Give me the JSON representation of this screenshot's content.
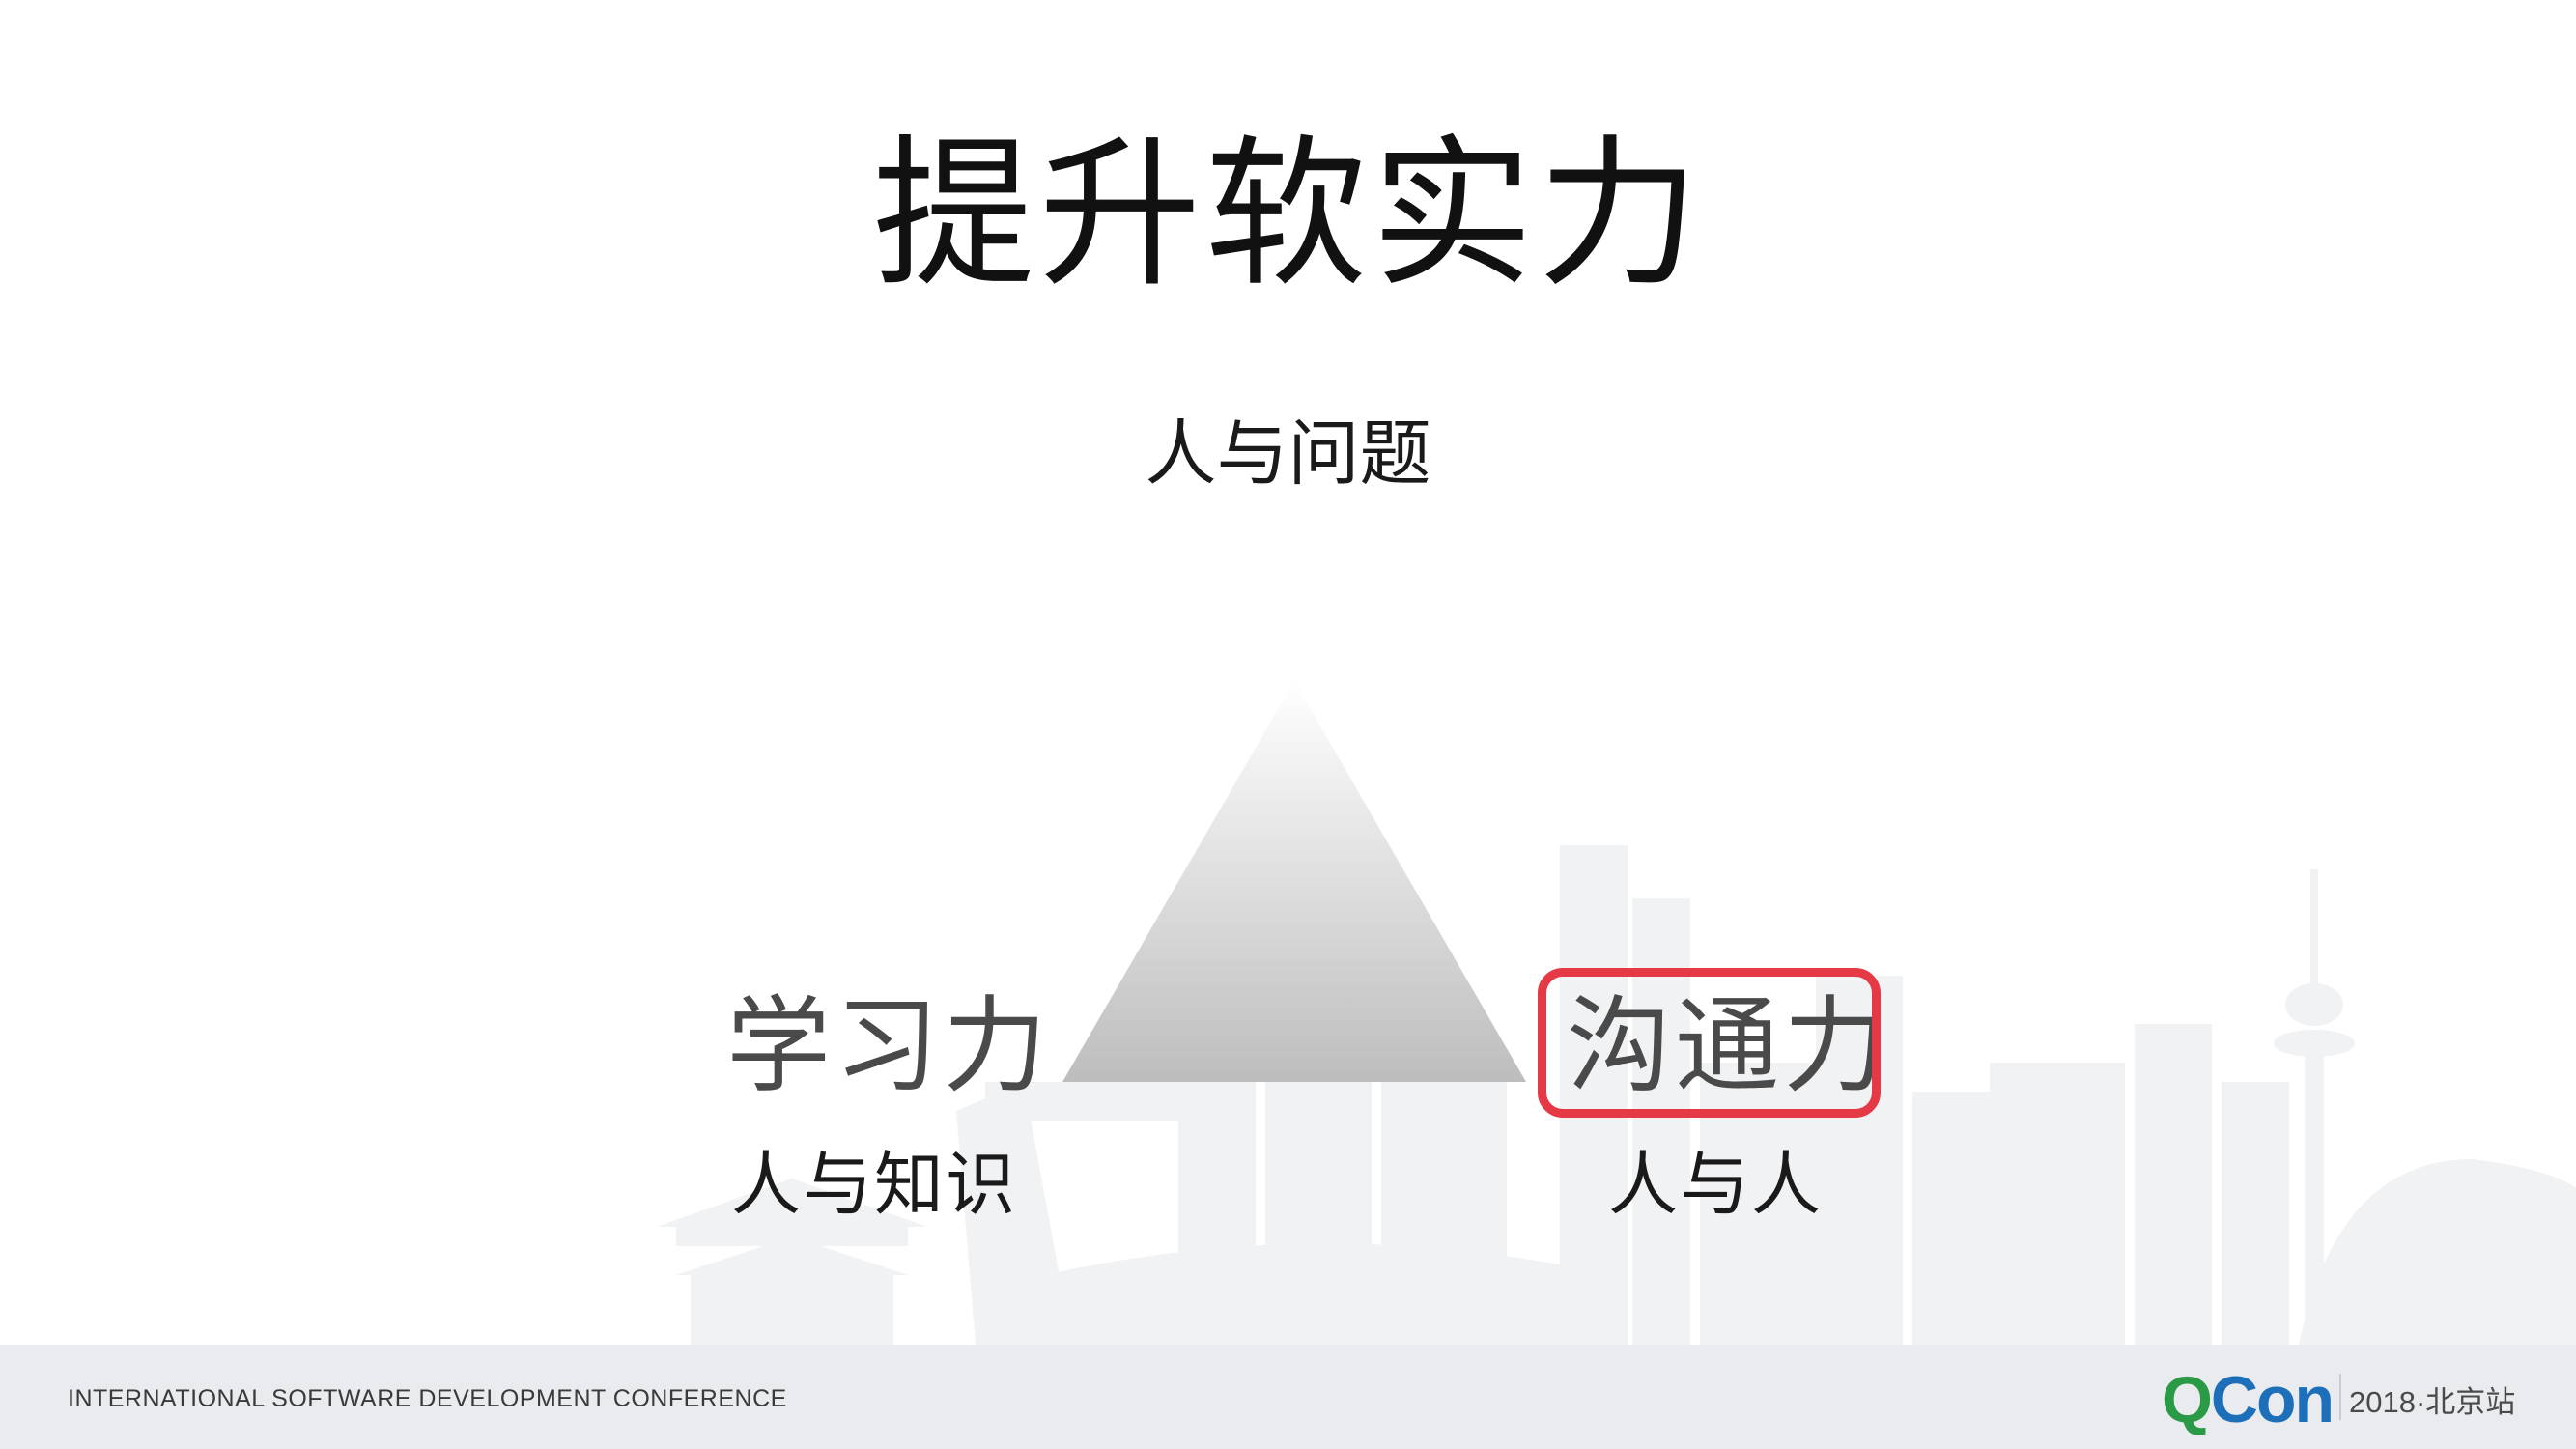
{
  "slide": {
    "title": "提升软实力",
    "top_label": "人与问题",
    "left": {
      "title": "学习力",
      "subtitle": "人与知识"
    },
    "right": {
      "title": "沟通力",
      "subtitle": "人与人"
    }
  },
  "footer": {
    "conference": "INTERNATIONAL SOFTWARE DEVELOPMENT CONFERENCE",
    "logo_q": "Q",
    "logo_con": "Con",
    "logo_sub": "2018·北京站"
  },
  "colors": {
    "highlight": "#e63946",
    "logo_blue": "#1c6fb8",
    "logo_green": "#2a9a47",
    "footer_bg": "#e9ebee"
  }
}
